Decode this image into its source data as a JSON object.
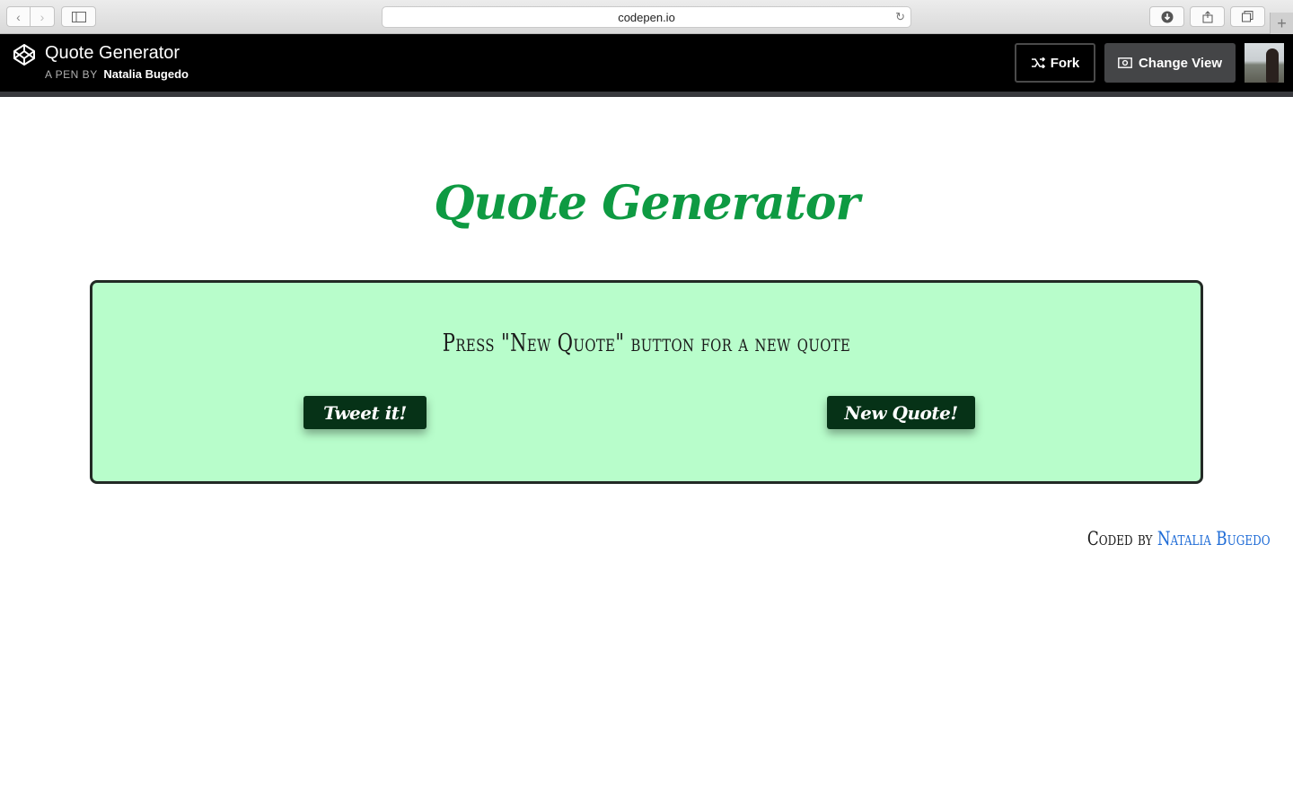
{
  "browser": {
    "url": "codepen.io",
    "back_icon": "chevron-left",
    "forward_icon": "chevron-right",
    "sidebar_icon": "sidebar",
    "reload_icon": "reload",
    "download_icon": "download",
    "share_icon": "share",
    "tabs_icon": "tabs",
    "new_tab_icon": "plus"
  },
  "header": {
    "pen_title": "Quote Generator",
    "pen_by_label": "A PEN BY",
    "author": "Natalia Bugedo",
    "fork_label": "Fork",
    "change_view_label": "Change View"
  },
  "page": {
    "title": "Quote Generator",
    "quote_text": "Press \"New Quote\" button for a new quote",
    "tweet_button": "Tweet it!",
    "new_quote_button": "New Quote!",
    "coded_by_label": "Coded by",
    "coded_by_name": "Natalia Bugedo"
  },
  "colors": {
    "title_green": "#0e9a42",
    "box_background": "#b8fdcb",
    "button_background": "#063217",
    "link_blue": "#1e6bd6"
  }
}
